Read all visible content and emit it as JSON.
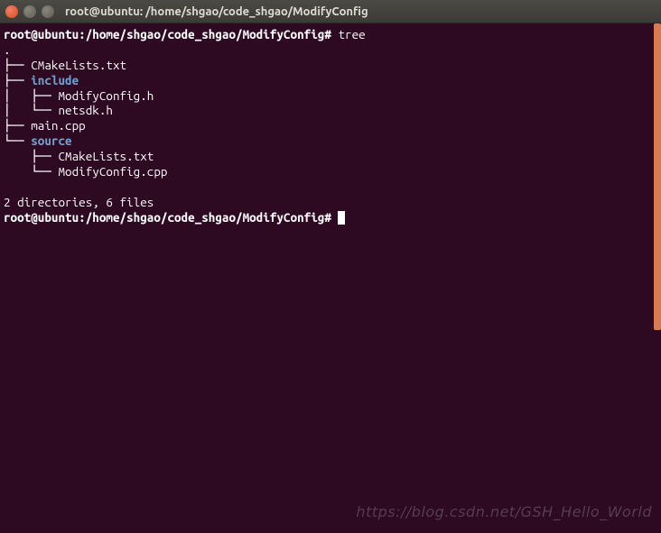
{
  "titlebar": {
    "title": "root@ubuntu: /home/shgao/code_shgao/ModifyConfig"
  },
  "terminal": {
    "prompt1_user": "root@ubuntu",
    "prompt1_path": ":/home/shgao/code_shgao/ModifyConfig#",
    "command1": " tree",
    "tree_root": ".",
    "tree_l1_a": "├── ",
    "tree_l1_a_name": "CMakeLists.txt",
    "tree_l1_b": "├── ",
    "tree_l1_b_name": "include",
    "tree_l2_b1": "│   ├── ",
    "tree_l2_b1_name": "ModifyConfig.h",
    "tree_l2_b2": "│   └── ",
    "tree_l2_b2_name": "netsdk.h",
    "tree_l1_c": "├── ",
    "tree_l1_c_name": "main.cpp",
    "tree_l1_d": "└── ",
    "tree_l1_d_name": "source",
    "tree_l2_d1": "    ├── ",
    "tree_l2_d1_name": "CMakeLists.txt",
    "tree_l2_d2": "    └── ",
    "tree_l2_d2_name": "ModifyConfig.cpp",
    "summary": "2 directories, 6 files",
    "prompt2_user": "root@ubuntu",
    "prompt2_path": ":/home/shgao/code_shgao/ModifyConfig#",
    "command2": " "
  },
  "watermark": "https://blog.csdn.net/GSH_Hello_World"
}
